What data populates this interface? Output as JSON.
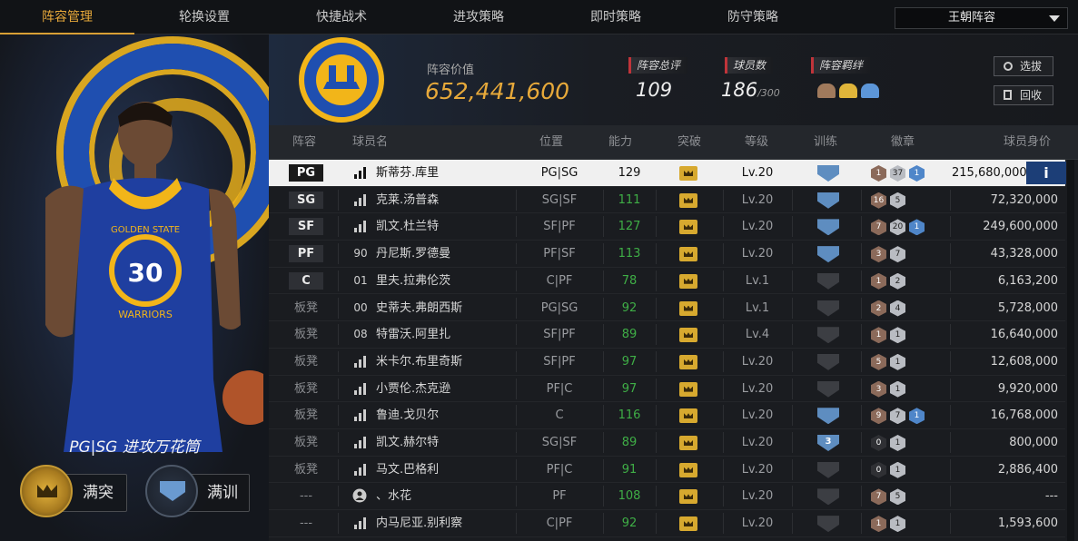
{
  "tabs": [
    "阵容管理",
    "轮换设置",
    "快捷战术",
    "进攻策略",
    "即时策略",
    "防守策略"
  ],
  "active_tab": 0,
  "lineup_select": "王朝阵容",
  "left_panel": {
    "jersey_number": "30",
    "jersey_team": "GOLDEN STATE",
    "jersey_text": "WARRIORS",
    "archetype": "PG|SG 进攻万花筒",
    "breakthrough_label": "满突",
    "training_label": "满训"
  },
  "summary": {
    "value_label": "阵容价值",
    "value": "652,441,600",
    "rating_label": "阵容总评",
    "rating": "109",
    "players_label": "球员数",
    "players": "186",
    "players_max": "/300",
    "bonds_label": "阵容羁绊",
    "select_label": "选拔",
    "recycle_label": "回收"
  },
  "headers": {
    "lineup": "阵容",
    "name": "球员名",
    "pos": "位置",
    "ability": "能力",
    "breakthrough": "突破",
    "level": "等级",
    "training": "训练",
    "badges": "徽章",
    "value": "球员身价"
  },
  "rows": [
    {
      "slot": "PG",
      "starter": true,
      "icon": "bars",
      "name": "斯蒂芬.库里",
      "pos": "PG|SG",
      "ability": "129",
      "level": "Lv.20",
      "train": "on",
      "train_num": "",
      "badges": [
        [
          "1",
          "br"
        ],
        [
          "37",
          "si"
        ],
        [
          "1",
          "bl"
        ]
      ],
      "value": "215,680,000",
      "selected": true
    },
    {
      "slot": "SG",
      "starter": true,
      "icon": "bars",
      "name": "克莱.汤普森",
      "pos": "SG|SF",
      "ability": "111",
      "level": "Lv.20",
      "train": "on",
      "train_num": "",
      "badges": [
        [
          "16",
          "br"
        ],
        [
          "5",
          "si"
        ]
      ],
      "value": "72,320,000",
      "selected": false
    },
    {
      "slot": "SF",
      "starter": true,
      "icon": "bars",
      "name": "凯文.杜兰特",
      "pos": "SF|PF",
      "ability": "127",
      "level": "Lv.20",
      "train": "on",
      "train_num": "",
      "badges": [
        [
          "7",
          "br"
        ],
        [
          "20",
          "si"
        ],
        [
          "1",
          "bl"
        ]
      ],
      "value": "249,600,000",
      "selected": false
    },
    {
      "slot": "PF",
      "starter": true,
      "icon": "90",
      "name": "丹尼斯.罗德曼",
      "pos": "PF|SF",
      "ability": "113",
      "level": "Lv.20",
      "train": "on",
      "train_num": "",
      "badges": [
        [
          "3",
          "br"
        ],
        [
          "7",
          "si"
        ]
      ],
      "value": "43,328,000",
      "selected": false
    },
    {
      "slot": "C",
      "starter": true,
      "icon": "01",
      "name": "里夫.拉弗伦茨",
      "pos": "C|PF",
      "ability": "78",
      "level": "Lv.1",
      "train": "off",
      "train_num": "",
      "badges": [
        [
          "1",
          "br"
        ],
        [
          "2",
          "si"
        ]
      ],
      "value": "6,163,200",
      "selected": false
    },
    {
      "slot": "板凳",
      "starter": false,
      "icon": "00",
      "name": "史蒂夫.弗朗西斯",
      "pos": "PG|SG",
      "ability": "92",
      "level": "Lv.1",
      "train": "off",
      "train_num": "",
      "badges": [
        [
          "2",
          "br"
        ],
        [
          "4",
          "si"
        ]
      ],
      "value": "5,728,000",
      "selected": false
    },
    {
      "slot": "板凳",
      "starter": false,
      "icon": "08",
      "name": "特雷沃.阿里扎",
      "pos": "SF|PF",
      "ability": "89",
      "level": "Lv.4",
      "train": "off",
      "train_num": "",
      "badges": [
        [
          "1",
          "br"
        ],
        [
          "1",
          "si"
        ]
      ],
      "value": "16,640,000",
      "selected": false
    },
    {
      "slot": "板凳",
      "starter": false,
      "icon": "bars",
      "name": "米卡尔.布里奇斯",
      "pos": "SF|PF",
      "ability": "97",
      "level": "Lv.20",
      "train": "off",
      "train_num": "",
      "badges": [
        [
          "5",
          "br"
        ],
        [
          "1",
          "si"
        ]
      ],
      "value": "12,608,000",
      "selected": false
    },
    {
      "slot": "板凳",
      "starter": false,
      "icon": "bars",
      "name": "小贾伦.杰克逊",
      "pos": "PF|C",
      "ability": "97",
      "level": "Lv.20",
      "train": "off",
      "train_num": "",
      "badges": [
        [
          "3",
          "br"
        ],
        [
          "1",
          "si"
        ]
      ],
      "value": "9,920,000",
      "selected": false
    },
    {
      "slot": "板凳",
      "starter": false,
      "icon": "bars",
      "name": "鲁迪.戈贝尔",
      "pos": "C",
      "ability": "116",
      "level": "Lv.20",
      "train": "on",
      "train_num": "",
      "badges": [
        [
          "9",
          "br"
        ],
        [
          "7",
          "si"
        ],
        [
          "1",
          "bl"
        ]
      ],
      "value": "16,768,000",
      "selected": false
    },
    {
      "slot": "板凳",
      "starter": false,
      "icon": "bars",
      "name": "凯文.赫尔特",
      "pos": "SG|SF",
      "ability": "89",
      "level": "Lv.20",
      "train": "on",
      "train_num": "3",
      "badges": [
        [
          "0",
          "dk"
        ],
        [
          "1",
          "si"
        ]
      ],
      "value": "800,000",
      "selected": false
    },
    {
      "slot": "板凳",
      "starter": false,
      "icon": "bars",
      "name": "马文.巴格利",
      "pos": "PF|C",
      "ability": "91",
      "level": "Lv.20",
      "train": "off",
      "train_num": "",
      "badges": [
        [
          "0",
          "dk"
        ],
        [
          "1",
          "si"
        ]
      ],
      "value": "2,886,400",
      "selected": false
    },
    {
      "slot": "---",
      "starter": false,
      "icon": "person",
      "name": "、水花",
      "pos": "PF",
      "ability": "108",
      "level": "Lv.20",
      "train": "off",
      "train_num": "",
      "badges": [
        [
          "7",
          "br"
        ],
        [
          "5",
          "si"
        ]
      ],
      "value": "---",
      "selected": false
    },
    {
      "slot": "---",
      "starter": false,
      "icon": "bars",
      "name": "内马尼亚.别利察",
      "pos": "C|PF",
      "ability": "92",
      "level": "Lv.20",
      "train": "off",
      "train_num": "",
      "badges": [
        [
          "1",
          "br"
        ],
        [
          "1",
          "si"
        ]
      ],
      "value": "1,593,600",
      "selected": false
    }
  ],
  "info_label": "i",
  "colors": {
    "accent": "#e7a93a",
    "green": "#3fae46",
    "badge_blue": "#4f86c9"
  }
}
